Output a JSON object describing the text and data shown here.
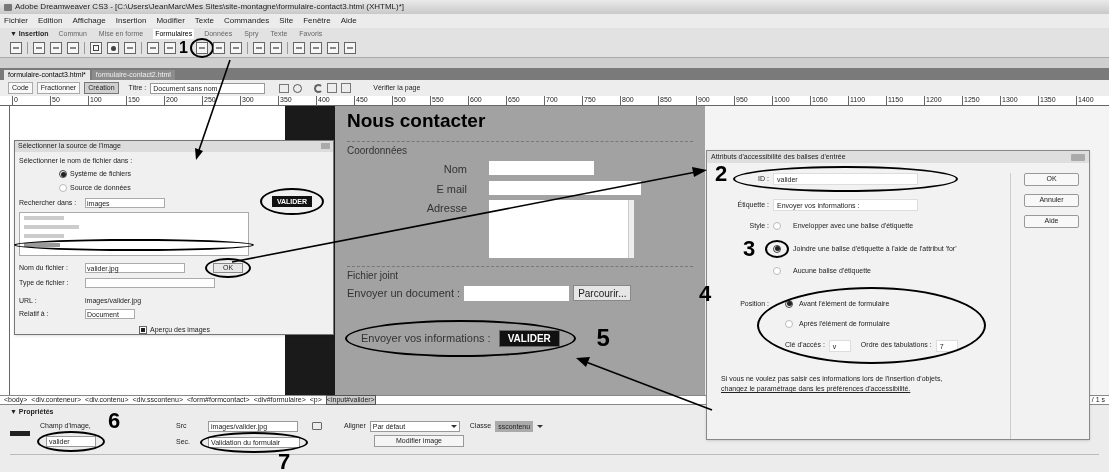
{
  "window": {
    "title": "Adobe Dreamweaver CS3 - [C:\\Users\\JeanMarc\\Mes Sites\\site-montagne\\formulaire-contact3.html (XHTML)*]"
  },
  "menu": [
    "Fichier",
    "Edition",
    "Affichage",
    "Insertion",
    "Modifier",
    "Texte",
    "Commandes",
    "Site",
    "Fenêtre",
    "Aide"
  ],
  "insert_panel": {
    "title": "▼ Insertion",
    "tabs": [
      {
        "label": "Commun",
        "selected": false
      },
      {
        "label": "Mise en forme",
        "selected": false
      },
      {
        "label": "Formulaires",
        "selected": true
      },
      {
        "label": "Données",
        "selected": false
      },
      {
        "label": "Spry",
        "selected": false
      },
      {
        "label": "Texte",
        "selected": false
      },
      {
        "label": "Favoris",
        "selected": false
      }
    ]
  },
  "document_tabs": [
    {
      "label": "formulaire-contact3.html*",
      "selected": true
    },
    {
      "label": "formulaire-contact2.html",
      "selected": false
    }
  ],
  "document_toolbar": {
    "views": [
      {
        "label": "Code",
        "selected": false
      },
      {
        "label": "Fractionner",
        "selected": false
      },
      {
        "label": "Création",
        "selected": true
      }
    ],
    "title_label": "Titre :",
    "title_value": "Document sans nom",
    "check_page": "Vérifier la page"
  },
  "ruler": [
    "0",
    "50",
    "100",
    "150",
    "200",
    "250",
    "300",
    "350",
    "400",
    "450",
    "500",
    "550",
    "600",
    "650",
    "700",
    "750",
    "800",
    "850",
    "900",
    "950",
    "1000",
    "1050",
    "1100",
    "1150",
    "1200",
    "1250",
    "1300",
    "1350",
    "1400"
  ],
  "page": {
    "heading": "Nous contacter",
    "sections": [
      {
        "legend": "Coordonnées",
        "fields": [
          {
            "label": "Nom",
            "kind": "text"
          },
          {
            "label": "E mail",
            "kind": "wide"
          },
          {
            "label": "Adresse",
            "kind": "textarea"
          }
        ]
      },
      {
        "legend": "Fichier joint",
        "fields": [
          {
            "label": "Envoyer un document :",
            "kind": "file",
            "button": "Parcourir..."
          }
        ]
      }
    ],
    "submit": {
      "label": "Envoyer vos informations :",
      "button": "VALIDER"
    }
  },
  "tag_selector": {
    "tags": [
      {
        "label": "<body>",
        "selected": false
      },
      {
        "label": "<div.conteneur>",
        "selected": false
      },
      {
        "label": "<div.contenu>",
        "selected": false
      },
      {
        "label": "<div.sscontenu>",
        "selected": false
      },
      {
        "label": "<form#formcontact>",
        "selected": false
      },
      {
        "label": "<div#formulaire>",
        "selected": false
      },
      {
        "label": "<p>",
        "selected": false
      },
      {
        "label": "<input#valider>",
        "selected": true
      }
    ],
    "status": "/ 1 s"
  },
  "properties": {
    "title": "▼ Propriétés",
    "type_label": "Champ d'image,",
    "name_value": "valider",
    "src_label": "Src",
    "src_value": "images/valider.jpg",
    "alt_label": "Sec.",
    "alt_value": "Validation du formulair",
    "align_label": "Aligner",
    "align_value": "Par défaut",
    "class_label": "Classe",
    "class_value": "sscontenu",
    "edit_button": "Modifier image"
  },
  "image_dialog": {
    "title": "Sélectionner la source de l'image",
    "select_from": "Sélectionner le nom de fichier dans :",
    "sources": [
      {
        "label": "Système de fichiers",
        "selected": true
      },
      {
        "label": "Source de données",
        "selected": false
      }
    ],
    "look_in_label": "Rechercher dans :",
    "look_in_value": "images",
    "preview_button": "VALIDER",
    "filename_label": "Nom du fichier :",
    "filename_value": "valider.jpg",
    "ok": "OK",
    "filetype_label": "Type de fichier :",
    "url_label": "URL :",
    "url_value": "images/valider.jpg",
    "relative_label": "Relatif à :",
    "relative_value": "Document",
    "preview_images": {
      "label": "Aperçu des images",
      "checked": true
    }
  },
  "accessibility_dialog": {
    "title": "Attributs d'accessibilité des balises d'entrée",
    "id_label": "ID :",
    "id_value": "valider",
    "label_label": "Étiquette :",
    "label_value": "Envoyer vos informations :",
    "style_label": "Style :",
    "styles": [
      {
        "label": "Envelopper avec une balise d'étiquette",
        "selected": false
      },
      {
        "label": "Joindre une balise d'étiquette à l'aide de l'attribut 'for'",
        "selected": true
      },
      {
        "label": "Aucune balise d'étiquette",
        "selected": false
      }
    ],
    "position_label": "Position :",
    "positions": [
      {
        "label": "Avant l'élément de formulaire",
        "selected": true
      },
      {
        "label": "Après l'élément de formulaire",
        "selected": false
      }
    ],
    "access_key_label": "Clé d'accès :",
    "access_key_value": "v",
    "tab_order_label": "Ordre des tabulations :",
    "tab_order_value": "7",
    "note": "Si vous ne voulez pas saisir ces informations lors de l'insertion d'objets,",
    "note_link": "changez le paramétrage dans les préférences d'accessibilité.",
    "buttons": [
      "OK",
      "Annuler",
      "Aide"
    ]
  },
  "annotations": [
    {
      "label": "1"
    },
    {
      "label": "2"
    },
    {
      "label": "3"
    },
    {
      "label": "4"
    },
    {
      "label": "5"
    },
    {
      "label": "6"
    },
    {
      "label": "7"
    }
  ]
}
